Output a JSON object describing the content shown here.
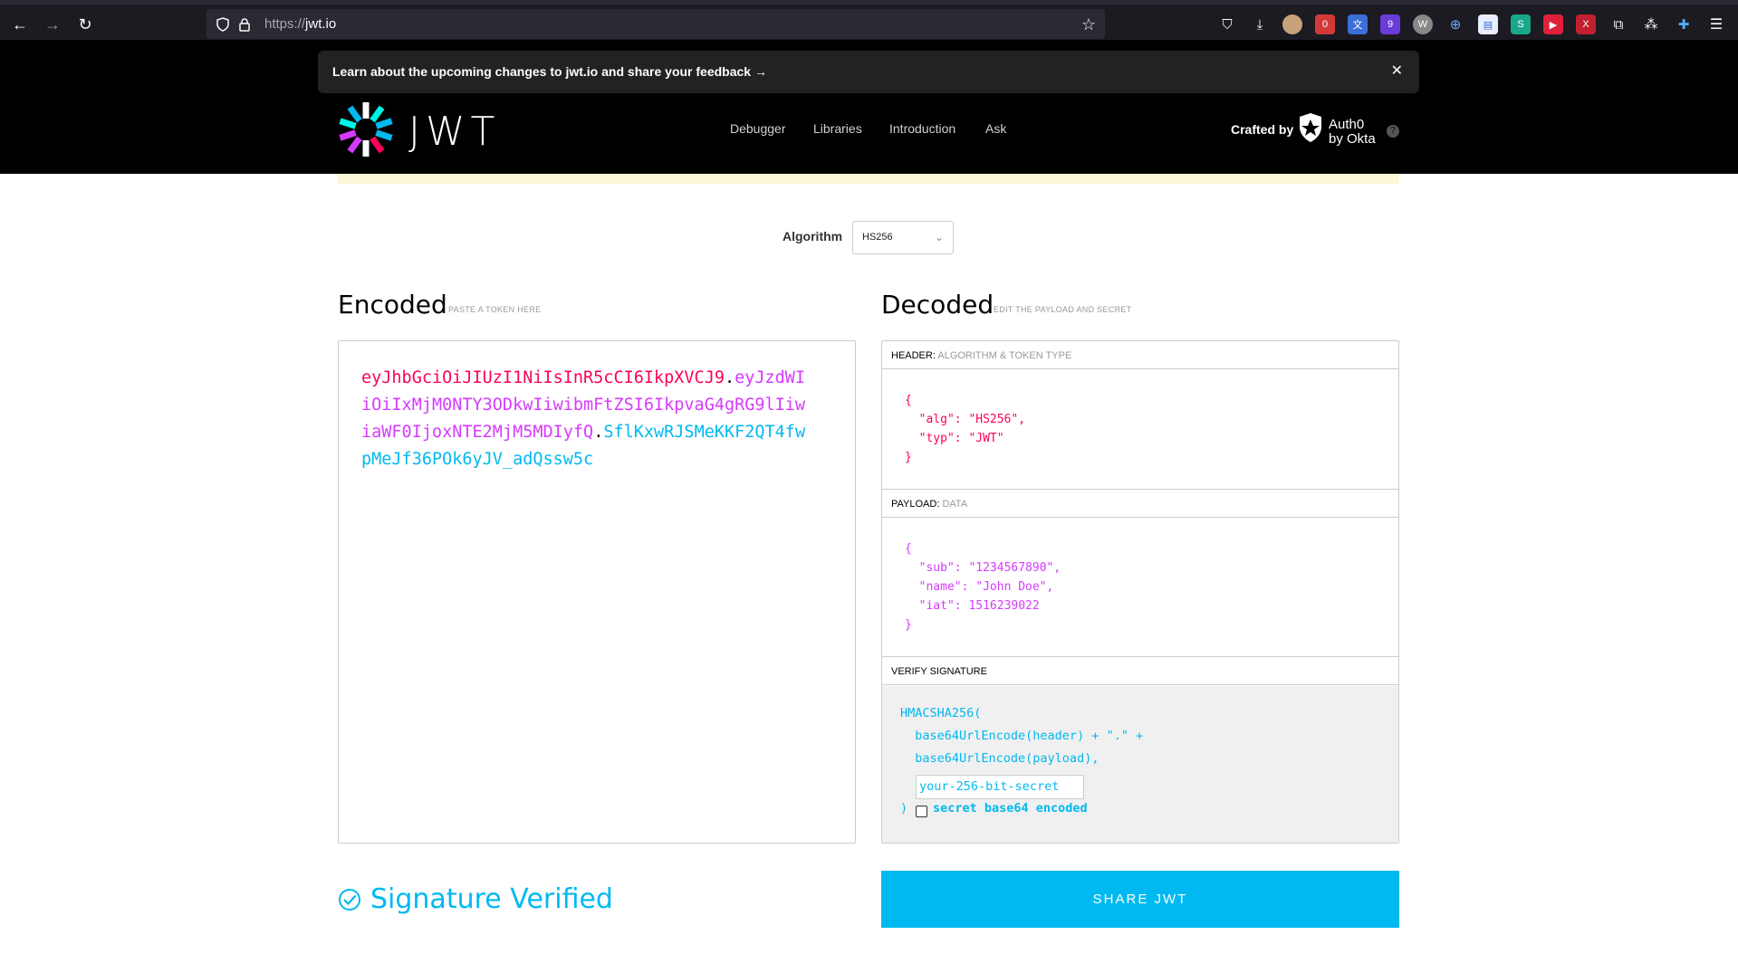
{
  "browser": {
    "url_scheme": "https://",
    "url_host": "jwt.io"
  },
  "banner": {
    "text": "Learn about the upcoming changes to jwt.io and share your feedback",
    "arrow": "→",
    "close": "✕"
  },
  "header": {
    "logo_text": "JWT",
    "nav": [
      "Debugger",
      "Libraries",
      "Introduction",
      "Ask"
    ],
    "crafted_by": "Crafted by",
    "auth0_line1": "Auth0",
    "auth0_line2": "by Okta",
    "help": "?"
  },
  "algorithm": {
    "label": "Algorithm",
    "value": "HS256"
  },
  "encoded": {
    "title": "Encoded",
    "subtitle": "PASTE A TOKEN HERE",
    "header_part": "eyJhbGciOiJIUzI1NiIsInR5cCI6IkpXVCJ9",
    "payload_part": "eyJzdWIiOiIxMjM0NTY3ODkwIiwibmFtZSI6IkpvaG4gRG9lIiwiaWF0IjoxNTE2MjM5MDIyfQ",
    "signature_part": "SflKxwRJSMeKKF2QT4fwpMeJf36POk6yJV_adQssw5c",
    "dot": "."
  },
  "decoded": {
    "title": "Decoded",
    "subtitle": "EDIT THE PAYLOAD AND SECRET",
    "header_label": "HEADER:",
    "header_dim": "ALGORITHM & TOKEN TYPE",
    "header_json": [
      "{",
      "  \"alg\": \"HS256\",",
      "  \"typ\": \"JWT\"",
      "}"
    ],
    "payload_label": "PAYLOAD:",
    "payload_dim": "DATA",
    "payload_json": [
      "{",
      "  \"sub\": \"1234567890\",",
      "  \"name\": \"John Doe\",",
      "  \"iat\": 1516239022",
      "}"
    ],
    "verify_label": "VERIFY SIGNATURE",
    "sig_lines": [
      "HMACSHA256(",
      "  base64UrlEncode(header) + \".\" +",
      "  base64UrlEncode(payload),"
    ],
    "secret_value": "your-256-bit-secret",
    "close_paren": ")",
    "secret_b64_label": "secret base64 encoded"
  },
  "status": {
    "verified": "Signature Verified"
  },
  "share_button": "SHARE JWT",
  "colors": {
    "header": "#fb015b",
    "payload": "#d63aff",
    "signature": "#00b9f1"
  }
}
